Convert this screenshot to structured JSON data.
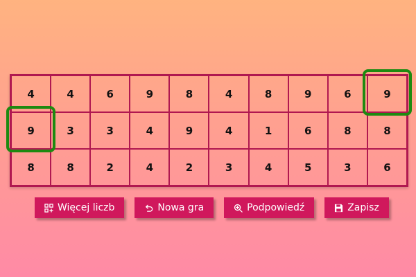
{
  "board": {
    "rows": [
      [
        "4",
        "4",
        "6",
        "9",
        "8",
        "4",
        "8",
        "9",
        "6",
        "9"
      ],
      [
        "9",
        "3",
        "3",
        "4",
        "9",
        "4",
        "1",
        "6",
        "8",
        "8"
      ],
      [
        "8",
        "8",
        "2",
        "4",
        "2",
        "3",
        "4",
        "5",
        "3",
        "6"
      ]
    ],
    "selected": [
      [
        0,
        9
      ],
      [
        1,
        0
      ]
    ],
    "highlight_color": "#1e8a10",
    "grid_color": "#b01850"
  },
  "toolbar": {
    "more_numbers_label": "Więcej liczb",
    "more_numbers_icon": "grid-plus-icon",
    "new_game_label": "Nowa gra",
    "new_game_icon": "undo-arrow-icon",
    "hint_label": "Podpowiedź",
    "hint_icon": "zoom-in-icon",
    "save_label": "Zapisz",
    "save_icon": "floppy-disk-icon",
    "button_color": "#d0185c"
  }
}
